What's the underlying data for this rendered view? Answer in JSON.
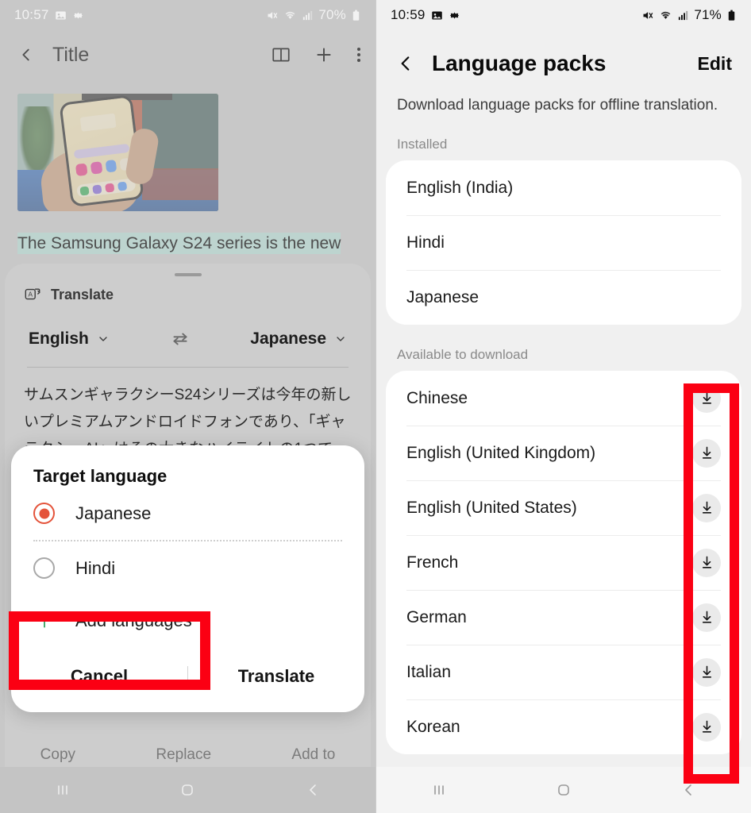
{
  "left_panel": {
    "status_bar": {
      "time": "10:57",
      "battery": "70%",
      "icons": [
        "image-icon",
        "gear-icon",
        "mute-icon",
        "wifi-icon",
        "signal-icon",
        "battery-icon"
      ]
    },
    "app_bar": {
      "back_icon": "chevron-left-icon",
      "title": "Title",
      "actions": [
        "book-icon",
        "plus-icon",
        "more-vertical-icon"
      ]
    },
    "article": {
      "image_alt": "hand-holding-phone-photo",
      "highlighted_text": "The Samsung Galaxy S24 series is the new"
    },
    "translate_sheet": {
      "icon": "translate-icon",
      "label": "Translate",
      "source_language": "English",
      "target_language": "Japanese",
      "swap_icon": "swap-horizontal-icon",
      "chevron_icon": "chevron-down-icon",
      "translated_text": "サムスンギャラクシーS24シリーズは今年の新しいプレミアムアンドロイドフォンであり、「ギャラクシーAI」はその大きなハイライトの1つです。 サム"
    },
    "ghost_actions": [
      "Copy",
      "Replace",
      "Add to"
    ],
    "dialog": {
      "title": "Target language",
      "options": [
        {
          "label": "Japanese",
          "selected": true
        },
        {
          "label": "Hindi",
          "selected": false
        }
      ],
      "add_languages": {
        "label": "Add languages",
        "icon": "plus-icon"
      },
      "cancel_label": "Cancel",
      "confirm_label": "Translate"
    },
    "nav_bar": {
      "recents_icon": "recents-icon",
      "home_icon": "home-icon",
      "back_icon": "back-icon"
    }
  },
  "right_panel": {
    "status_bar": {
      "time": "10:59",
      "battery": "71%",
      "icons": [
        "image-icon",
        "gear-icon",
        "mute-icon",
        "wifi-icon",
        "signal-icon",
        "battery-icon"
      ]
    },
    "app_bar": {
      "back_icon": "chevron-left-icon",
      "title": "Language packs",
      "edit_label": "Edit"
    },
    "subtitle": "Download language packs for offline translation.",
    "installed_section": {
      "label": "Installed",
      "items": [
        {
          "name": "English (India)"
        },
        {
          "name": "Hindi"
        },
        {
          "name": "Japanese"
        }
      ]
    },
    "available_section": {
      "label": "Available to download",
      "download_icon": "download-icon",
      "items": [
        {
          "name": "Chinese"
        },
        {
          "name": "English (United Kingdom)"
        },
        {
          "name": "English (United States)"
        },
        {
          "name": "French"
        },
        {
          "name": "German"
        },
        {
          "name": "Italian"
        },
        {
          "name": "Korean"
        }
      ]
    },
    "nav_bar": {
      "recents_icon": "recents-icon",
      "home_icon": "home-icon",
      "back_icon": "back-icon"
    }
  },
  "annotations": {
    "highlight_color": "#fb0013",
    "boxes": [
      {
        "name": "add-languages-highlight"
      },
      {
        "name": "download-buttons-highlight"
      }
    ]
  },
  "colors": {
    "accent_red": "#e4533a",
    "accent_green": "#3aa463",
    "highlight_green": "#bdd4cf"
  }
}
